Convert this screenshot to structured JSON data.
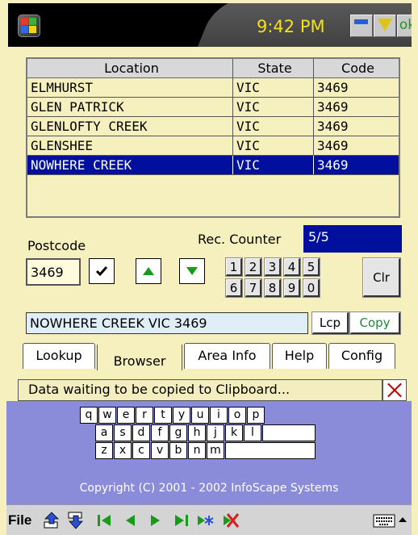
{
  "title_bar": {
    "time": "9:42 PM",
    "ok_label": "ok"
  },
  "grid": {
    "columns": [
      "Location",
      "State",
      "Code"
    ],
    "rows": [
      {
        "location": "ELMHURST",
        "state": "VIC",
        "code": "3469"
      },
      {
        "location": "GLEN PATRICK",
        "state": "VIC",
        "code": "3469"
      },
      {
        "location": "GLENLOFTY CREEK",
        "state": "VIC",
        "code": "3469"
      },
      {
        "location": "GLENSHEE",
        "state": "VIC",
        "code": "3469"
      },
      {
        "location": "NOWHERE CREEK",
        "state": "VIC",
        "code": "3469",
        "selected": true
      }
    ]
  },
  "form": {
    "postcode_label": "Postcode",
    "postcode_value": "3469",
    "rec_counter_label": "Rec. Counter",
    "rec_counter_value": "5/5",
    "address_value": "NOWHERE CREEK VIC  3469"
  },
  "keypad": {
    "row1": [
      "1",
      "2",
      "3",
      "4",
      "5"
    ],
    "row2": [
      "6",
      "7",
      "8",
      "9",
      "0"
    ],
    "clear_label": "Clr"
  },
  "buttons": {
    "lcp_label": "Lcp",
    "copy_label": "Copy"
  },
  "tabs": [
    "Lookup",
    "Browser",
    "Area Info",
    "Help",
    "Config"
  ],
  "active_tab": "Browser",
  "status": {
    "message": "Data waiting to be copied to Clipboard..."
  },
  "keyboard": {
    "row1": [
      "q",
      "w",
      "e",
      "r",
      "t",
      "y",
      "u",
      "i",
      "o",
      "p"
    ],
    "row2": [
      "a",
      "s",
      "d",
      "f",
      "g",
      "h",
      "j",
      "k",
      "l"
    ],
    "row3": [
      "z",
      "x",
      "c",
      "v",
      "b",
      "n",
      "m"
    ]
  },
  "copyright": "Copyright (C) 2001 - 2002 InfoScape Systems",
  "toolbar": {
    "file_label": "File"
  },
  "colors": {
    "selection": "#00109c",
    "grid_background": "#f6efbe",
    "keyboard_panel": "#8a8cd9",
    "nav_arrows": "#1a9a1a",
    "time_text": "#f3e01a"
  }
}
